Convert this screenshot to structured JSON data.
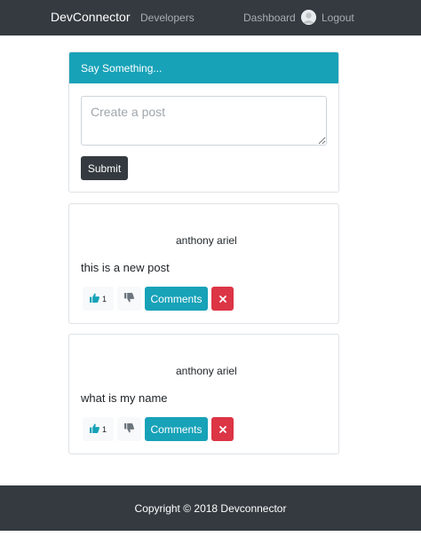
{
  "navbar": {
    "brand": "DevConnector",
    "developers_label": "Developers",
    "dashboard_label": "Dashboard",
    "logout_label": "Logout"
  },
  "post_form": {
    "header": "Say Something...",
    "placeholder": "Create a post",
    "submit_label": "Submit"
  },
  "posts": [
    {
      "author": "anthony ariel",
      "text": "this is a new post",
      "likes": "1",
      "comments_label": "Comments"
    },
    {
      "author": "anthony ariel",
      "text": "what is my name",
      "likes": "1",
      "comments_label": "Comments"
    }
  ],
  "footer": {
    "copyright": "Copyright © 2018 Devconnector"
  },
  "colors": {
    "navbar": "#343a40",
    "accent": "#17a2b8",
    "danger": "#dc3545",
    "like_icon": "#17a2b8",
    "dislike_icon": "#6c757d"
  },
  "icons": {
    "like": "thumbs-up-icon",
    "dislike": "thumbs-down-icon",
    "delete": "times-icon",
    "avatar": "user-avatar-icon"
  }
}
